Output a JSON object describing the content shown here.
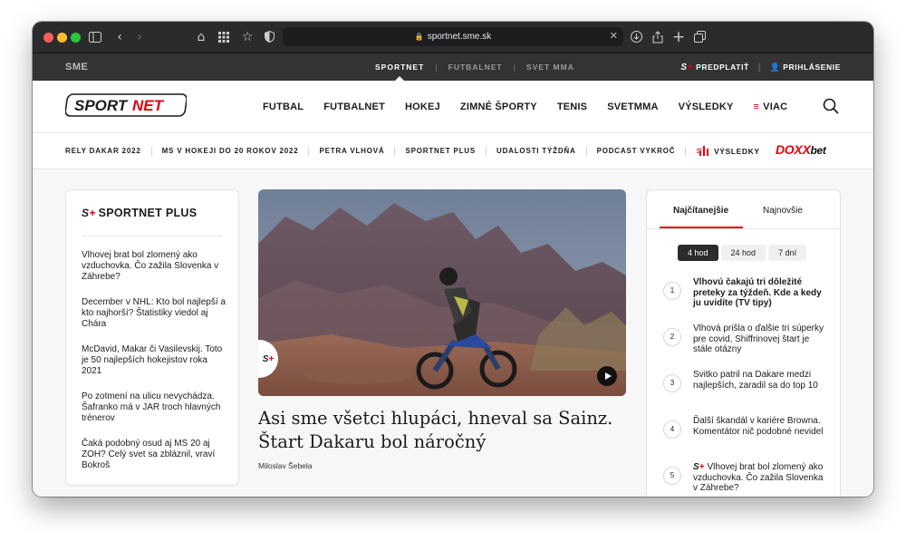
{
  "browser": {
    "url": "sportnet.sme.sk",
    "traffic_lights": [
      "#ff5f57",
      "#febc2e",
      "#28c840"
    ]
  },
  "sme_bar": {
    "logo": "SME",
    "links": [
      {
        "label": "SPORTNET",
        "active": true
      },
      {
        "label": "FUTBALNET",
        "active": false
      },
      {
        "label": "SVET MMA",
        "active": false
      }
    ],
    "splus_s": "S",
    "splus_p": "+",
    "predplatit": "PREDPLATIŤ",
    "prihlasenie": "PRIHLÁSENIE"
  },
  "main_nav": {
    "logo": "SPORTNET",
    "items": [
      "FUTBAL",
      "FUTBALNET",
      "HOKEJ",
      "ZIMNÉ ŠPORTY",
      "TENIS",
      "SVETMMA",
      "VÝSLEDKY"
    ],
    "more": "VIAC"
  },
  "sub_nav": {
    "items": [
      "RELY DAKAR 2022",
      "MS V HOKEJI DO 20 ROKOV 2022",
      "PETRA VLHOVÁ",
      "SPORTNET PLUS",
      "UDALOSTI TÝŽDŇA",
      "PODCAST VYKROČ"
    ],
    "vysledky": "VÝSLEDKY",
    "doxx": "DOXX",
    "bet": "bet"
  },
  "left_card": {
    "title": "SPORTNET PLUS",
    "articles": [
      "Vlhovej brat bol zlomený ako vzduchovka. Čo zažila Slovenka v Záhrebe?",
      "December v NHL: Kto bol najlepší a kto najhorší? Štatistiky viedol aj Chára",
      "McDavid, Makar či Vasilevskij. Toto je 50 najlepších hokejistov roka 2021",
      "Po zotmení na ulicu nevychádza. Šafranko má v JAR troch hlavných trénerov",
      "Čaká podobný osud aj MS 20 aj ZOH? Celý svet sa zbláznil, vraví Bokroš"
    ]
  },
  "hero": {
    "headline": "Asi sme všetci hlupáci, hneval sa Sainz. Štart Dakaru bol náročný",
    "author": "Miloslav Šebela"
  },
  "right_card": {
    "tabs": [
      "Najčítanejšie",
      "Najnovšie"
    ],
    "periods": [
      "4 hod",
      "24 hod",
      "7 dní"
    ],
    "ranking": [
      {
        "num": "1",
        "text": "Vlhovú čakajú tri dôležité preteky za týždeň. Kde a kedy ju uvidíte (TV tipy)",
        "bold": true
      },
      {
        "num": "2",
        "text": "Vlhová prišla o ďalšie tri súperky pre covid, Shiffrinovej štart je stále otázny",
        "bold": false
      },
      {
        "num": "3",
        "text": "Svitko patril na Dakare medzi najlepších, zaradil sa do top 10",
        "bold": false
      },
      {
        "num": "4",
        "text": "Ďalší škandál v kariére Browna. Komentátor nič podobné nevidel",
        "bold": false
      },
      {
        "num": "5",
        "text": "Vlhovej brat bol zlomený ako vzduchovka. Čo zažila Slovenka v Záhrebe?",
        "bold": false
      }
    ]
  },
  "colors": {
    "accent": "#e3000f",
    "dark_bar": "#333333"
  }
}
